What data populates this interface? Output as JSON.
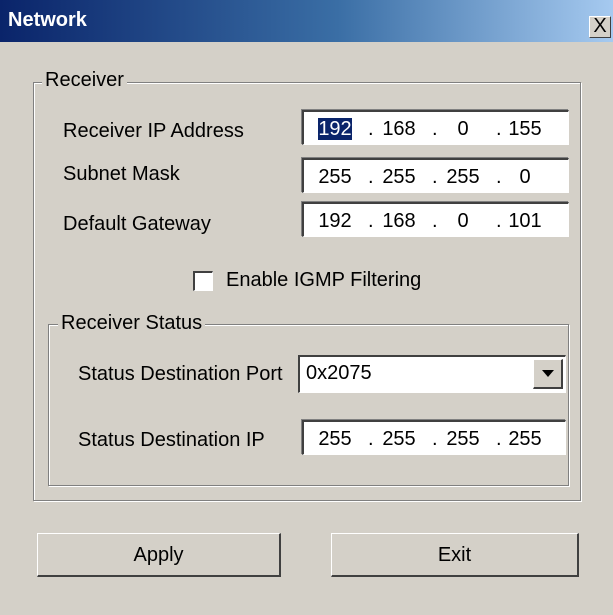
{
  "window": {
    "title": "Network",
    "close_glyph": "X"
  },
  "receiver": {
    "legend": "Receiver",
    "ip_label": "Receiver IP Address",
    "ip": [
      "192",
      "168",
      "0",
      "155"
    ],
    "subnet_label": "Subnet Mask",
    "subnet": [
      "255",
      "255",
      "255",
      "0"
    ],
    "gateway_label": "Default Gateway",
    "gateway": [
      "192",
      "168",
      "0",
      "101"
    ],
    "igmp_label": "Enable IGMP Filtering",
    "igmp_checked": false
  },
  "status": {
    "legend": "Receiver Status",
    "port_label": "Status Destination Port",
    "port_value": "0x2075",
    "ip_label": "Status Destination IP",
    "ip": [
      "255",
      "255",
      "255",
      "255"
    ]
  },
  "buttons": {
    "apply": "Apply",
    "exit": "Exit"
  },
  "ip_separator": "."
}
